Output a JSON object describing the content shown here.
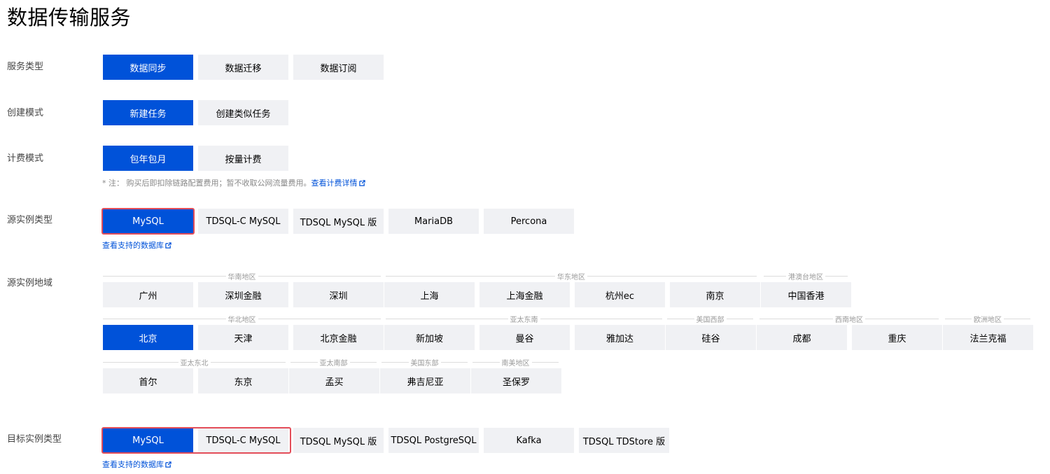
{
  "page_title": "数据传输服务",
  "service_type": {
    "label": "服务类型",
    "options": [
      "数据同步",
      "数据迁移",
      "数据订阅"
    ]
  },
  "create_mode": {
    "label": "创建模式",
    "options": [
      "新建任务",
      "创建类似任务"
    ]
  },
  "billing_mode": {
    "label": "计费模式",
    "options": [
      "包年包月",
      "按量计费"
    ],
    "note": "* 注：  购买后即扣除链路配置费用；暂不收取公网流量费用。",
    "note_link": "查看计费详情"
  },
  "source_type": {
    "label": "源实例类型",
    "options": [
      "MySQL",
      "TDSQL-C MySQL",
      "TDSQL MySQL 版",
      "MariaDB",
      "Percona"
    ],
    "support_link": "查看支持的数据库"
  },
  "source_region": {
    "label": "源实例地域",
    "groups": [
      "华南地区",
      "华东地区",
      "港澳台地区",
      "华北地区",
      "亚太东南",
      "美国西部",
      "西南地区",
      "欧洲地区",
      "亚太东北",
      "亚太南部",
      "美国东部",
      "南美地区"
    ],
    "regions": [
      "广州",
      "深圳金融",
      "深圳",
      "上海",
      "上海金融",
      "杭州ec",
      "南京",
      "中国香港",
      "北京",
      "天津",
      "北京金融",
      "新加坡",
      "曼谷",
      "雅加达",
      "硅谷",
      "成都",
      "重庆",
      "法兰克福",
      "首尔",
      "东京",
      "孟买",
      "弗吉尼亚",
      "圣保罗"
    ]
  },
  "target_type": {
    "label": "目标实例类型",
    "options": [
      "MySQL",
      "TDSQL-C MySQL",
      "TDSQL MySQL 版",
      "TDSQL PostgreSQL",
      "Kafka",
      "TDSQL TDStore 版"
    ],
    "support_link": "查看支持的数据库"
  },
  "colors": {
    "primary": "#0052d9",
    "option_bg": "#f0f1f4",
    "highlight": "#e34d59"
  }
}
